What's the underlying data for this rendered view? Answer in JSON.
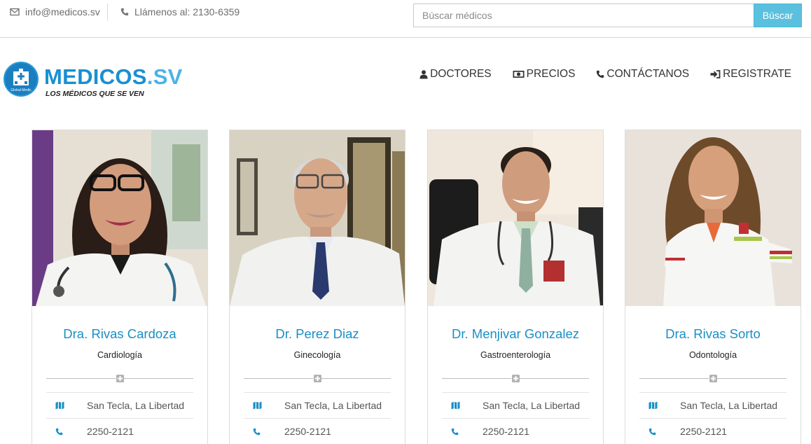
{
  "topbar": {
    "email": "info@medicos.sv",
    "phone": "Llámenos al: 2130-6359",
    "email_icon": "envelope-icon",
    "phone_icon": "phone-icon"
  },
  "search": {
    "placeholder": "Búscar médicos",
    "button_label": "Búscar"
  },
  "brand": {
    "name_part1": "MEDICOS",
    "name_part2": ".SV",
    "tagline": "LOS MÉDICOS QUE SE VEN",
    "logo_icon": "hospital-logo-icon",
    "logo_text": "Global Medic"
  },
  "nav": [
    {
      "label": "DOCTORES",
      "icon": "user-icon"
    },
    {
      "label": "PRECIOS",
      "icon": "money-icon"
    },
    {
      "label": "CONTÁCTANOS",
      "icon": "phone-icon"
    },
    {
      "label": "REGISTRATE",
      "icon": "sign-in-icon"
    }
  ],
  "doctors": [
    {
      "name": "Dra. Rivas Cardoza",
      "specialty": "Cardiología",
      "location": "San Tecla, La Libertad",
      "phone": "2250-2121"
    },
    {
      "name": "Dr. Perez Diaz",
      "specialty": "Ginecología",
      "location": "San Tecla, La Libertad",
      "phone": "2250-2121"
    },
    {
      "name": "Dr. Menjivar Gonzalez",
      "specialty": "Gastroenterología",
      "location": "San Tecla, La Libertad",
      "phone": "2250-2121"
    },
    {
      "name": "Dra. Rivas Sorto",
      "specialty": "Odontología",
      "location": "San Tecla, La Libertad",
      "phone": "2250-2121"
    }
  ],
  "colors": {
    "accent": "#1a8fc6",
    "search_button": "#5bc0de",
    "brand_dark": "#1a8fd1",
    "brand_light": "#4bb3e6"
  }
}
